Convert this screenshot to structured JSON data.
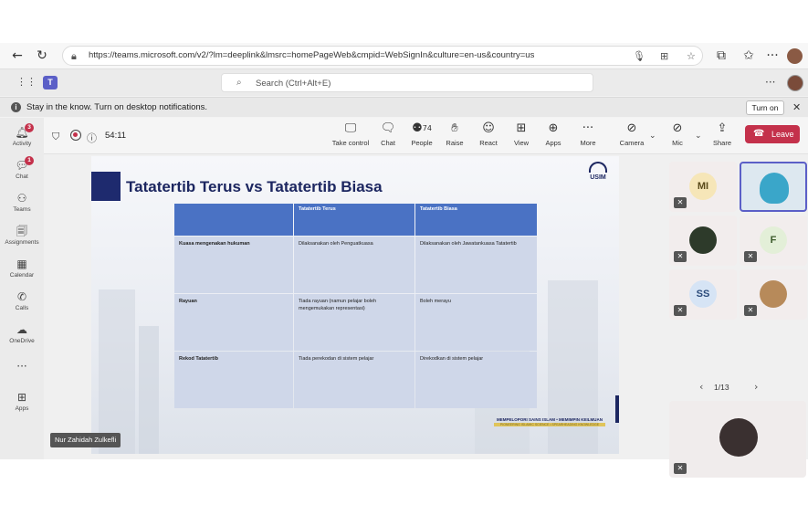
{
  "browser": {
    "url": "https://teams.microsoft.com/v2/?lm=deeplink&lmsrc=homePageWeb&cmpid=WebSignIn&culture=en-us&country=us"
  },
  "teams_header": {
    "search_placeholder": "Search (Ctrl+Alt+E)",
    "more": "···"
  },
  "notification": {
    "text": "Stay in the know. Turn on desktop notifications.",
    "button": "Turn on"
  },
  "rail": {
    "items": [
      {
        "label": "Activity",
        "icon": "bell-icon",
        "badge": "3"
      },
      {
        "label": "Chat",
        "icon": "chat-icon",
        "badge": "1"
      },
      {
        "label": "Teams",
        "icon": "teams-icon"
      },
      {
        "label": "Assignments",
        "icon": "assignments-icon"
      },
      {
        "label": "Calendar",
        "icon": "calendar-icon"
      },
      {
        "label": "Calls",
        "icon": "phone-icon"
      },
      {
        "label": "OneDrive",
        "icon": "cloud-icon"
      },
      {
        "label": "",
        "icon": "more-icon"
      },
      {
        "label": "Apps",
        "icon": "apps-icon"
      }
    ]
  },
  "meeting": {
    "timer": "54:11",
    "toolbar": {
      "take_control": "Take control",
      "chat": "Chat",
      "people": "People",
      "people_count": "74",
      "raise": "Raise",
      "react": "React",
      "view": "View",
      "apps": "Apps",
      "more": "More",
      "camera": "Camera",
      "mic": "Mic",
      "share": "Share",
      "leave": "Leave"
    },
    "accent_color": "#5b5fc7",
    "leave_color": "#c4314b"
  },
  "slide": {
    "title": "Tatatertib Terus vs Tatatertib Biasa",
    "logo_text": "USIM",
    "table": {
      "headers": [
        "",
        "Tatatertib Terus",
        "Tatatertib Biasa"
      ],
      "rows": [
        {
          "label": "Kuasa mengenakan hukuman",
          "terus": "Dilaksanakan oleh Penguatkuasa",
          "biasa": "Dilaksanakan oleh Jawatankuasa Tatatertib"
        },
        {
          "label": "Rayuan",
          "terus": "Tiada rayuan (namun pelajar boleh mengemukakan representasi)",
          "biasa": "Boleh merayu"
        },
        {
          "label": "Rekod Tatatertib",
          "terus": "Tiada perekodan di sistem pelajar",
          "biasa": "Direkodkan di sistem pelajar"
        }
      ]
    },
    "motto_line1": "MEMPELOPORI SAINS ISLAM • MEMIMPIN KEILMUAN",
    "motto_line2": "PIONEERING ISLAMIC SCIENCE • SPEARHEADING KNOWLEDGE",
    "presenter": "Nur Zahidah Zulkefli"
  },
  "gallery": {
    "participants": [
      {
        "initials": "MI",
        "bg": "#f6e6b8",
        "color": "#5a4a1a"
      },
      {
        "initials": "",
        "photo": true
      },
      {
        "initials": "",
        "photo": true
      },
      {
        "initials": "F",
        "bg": "#e3efd8",
        "color": "#3b5a2a"
      },
      {
        "initials": "SS",
        "bg": "#d6e4f5",
        "color": "#2a4a7a"
      },
      {
        "initials": "",
        "photo": true
      }
    ],
    "page": "1/13"
  }
}
